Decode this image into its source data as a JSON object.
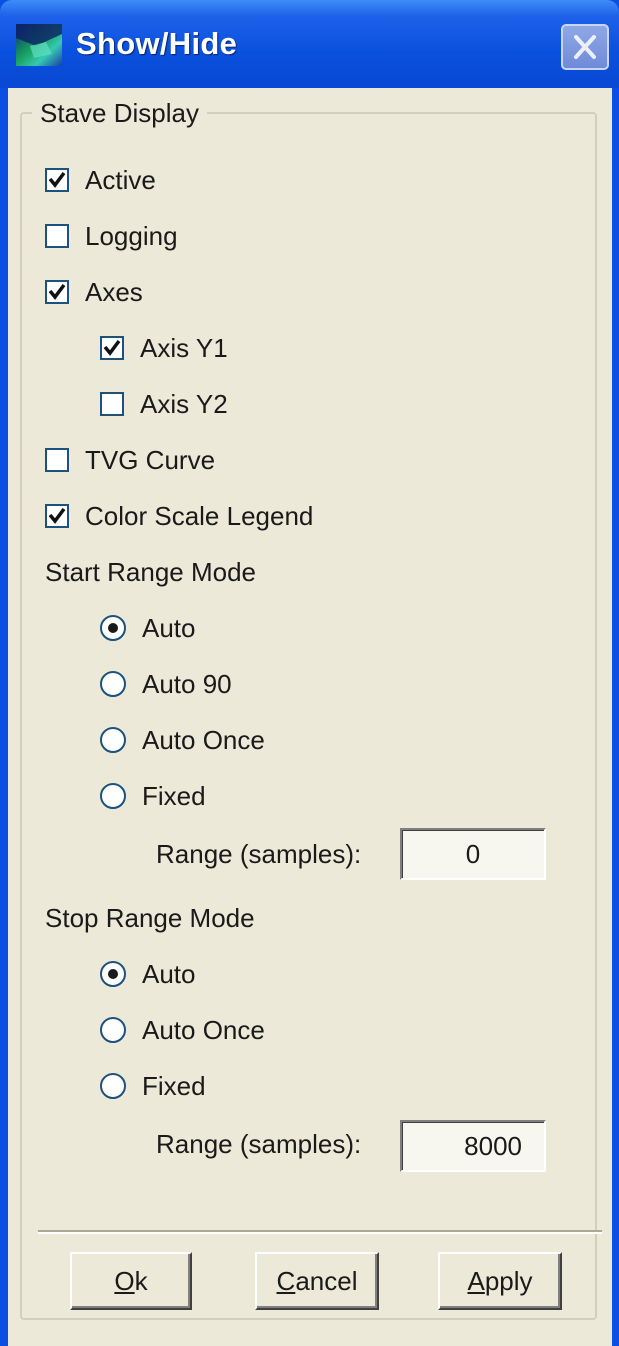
{
  "window": {
    "title": "Show/Hide",
    "close_label": "×"
  },
  "stave_display": {
    "group_title": "Stave Display",
    "checkboxes": {
      "active": {
        "label": "Active",
        "checked": true
      },
      "logging": {
        "label": "Logging",
        "checked": false
      },
      "axes": {
        "label": "Axes",
        "checked": true
      },
      "axis_y1": {
        "label": "Axis Y1",
        "checked": true
      },
      "axis_y2": {
        "label": "Axis Y2",
        "checked": false
      },
      "tvg_curve": {
        "label": "TVG Curve",
        "checked": false
      },
      "color_scale_legend": {
        "label": "Color Scale Legend",
        "checked": true
      }
    },
    "start_range_mode": {
      "label": "Start Range Mode",
      "options": [
        "Auto",
        "Auto 90",
        "Auto Once",
        "Fixed"
      ],
      "selected": "Auto",
      "range_label": "Range (samples):",
      "range_value": "0"
    },
    "stop_range_mode": {
      "label": "Stop Range Mode",
      "options": [
        "Auto",
        "Auto Once",
        "Fixed"
      ],
      "selected": "Auto",
      "range_label": "Range (samples):",
      "range_value": "8000"
    }
  },
  "buttons": {
    "ok": {
      "mnemonic": "O",
      "rest": "k"
    },
    "cancel": {
      "mnemonic": "C",
      "rest": "ancel"
    },
    "apply": {
      "mnemonic": "A",
      "rest": "pply"
    }
  }
}
